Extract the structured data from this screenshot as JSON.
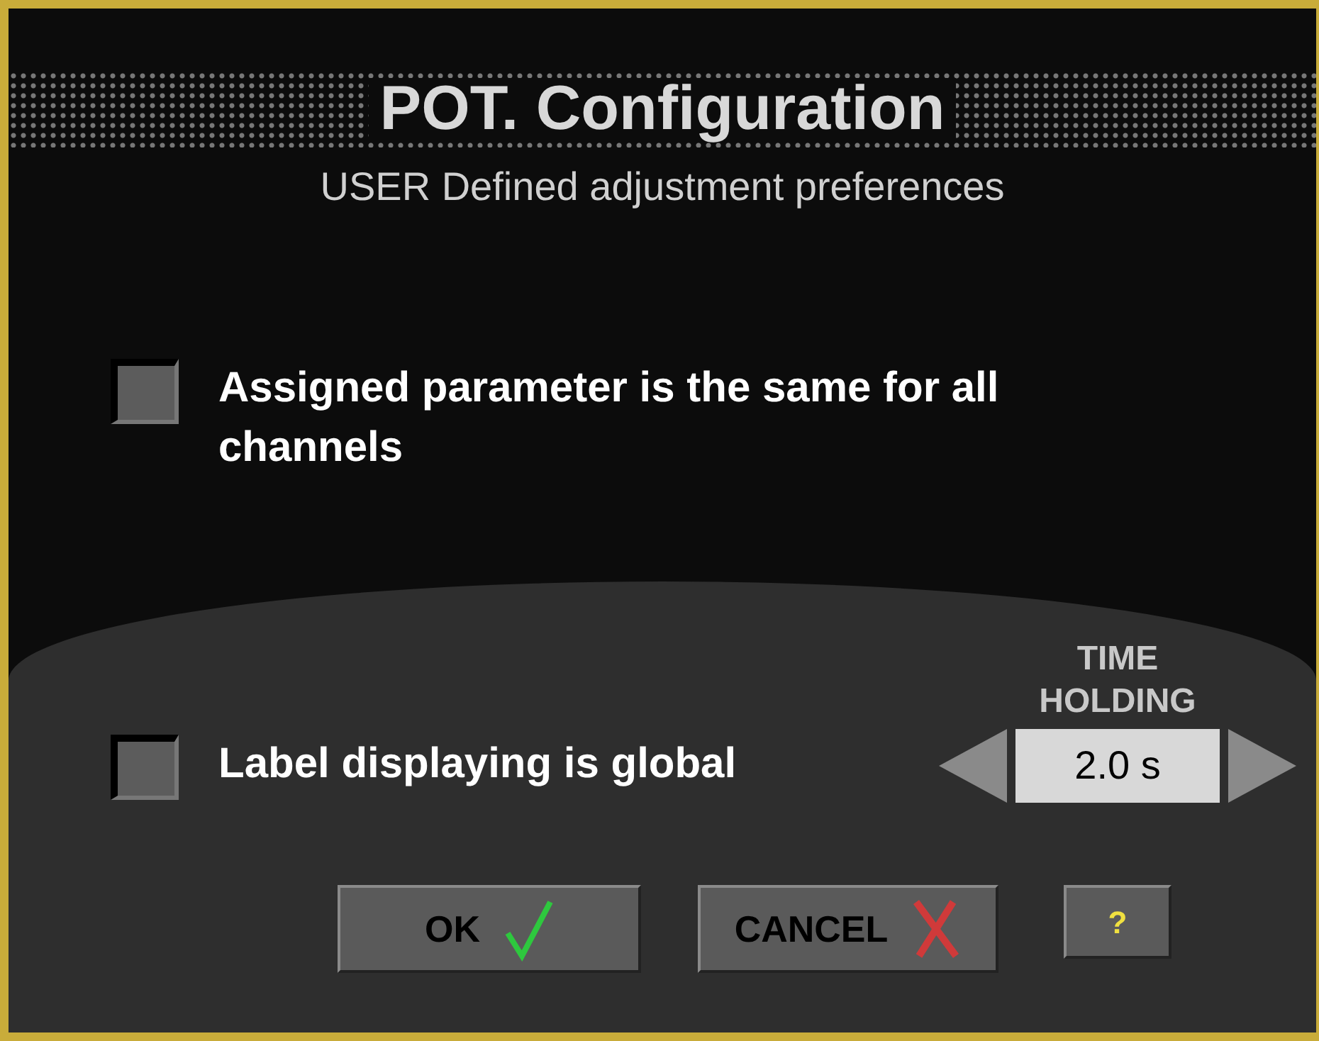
{
  "title": "POT. Configuration",
  "subtitle": "USER Defined adjustment preferences",
  "options": [
    {
      "label": "Assigned parameter is the same for all channels",
      "checked": false
    },
    {
      "label": "Label displaying is global",
      "checked": false
    }
  ],
  "time_holding": {
    "label_lines": [
      "TIME",
      "HOLDING"
    ],
    "value": "2.0 s"
  },
  "buttons": [
    {
      "kind": "ok",
      "label": "OK"
    },
    {
      "kind": "cancel",
      "label": "CANCEL"
    },
    {
      "kind": "help",
      "label": "?"
    }
  ]
}
